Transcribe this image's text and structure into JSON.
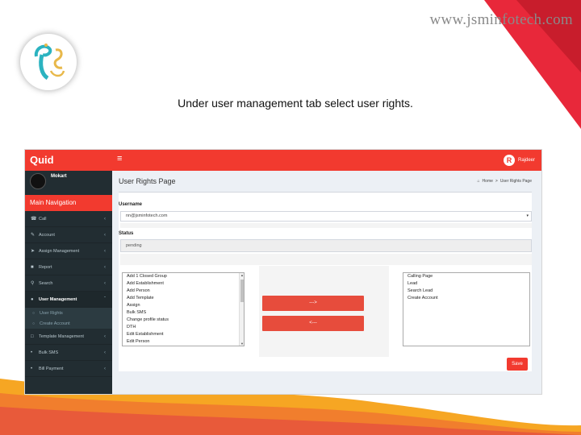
{
  "slide": {
    "watermark": "www.jsminfotech.com",
    "caption": "Under user management tab select user rights."
  },
  "app": {
    "brand": "Quid",
    "user_initial": "R",
    "user_name": "Rajdeer"
  },
  "sidebar": {
    "profile_name": "Mokart",
    "section_title": "Main Navigation",
    "items": [
      {
        "label": "Call"
      },
      {
        "label": "Account"
      },
      {
        "label": "Assign Management"
      },
      {
        "label": "Report"
      },
      {
        "label": "Search"
      },
      {
        "label": "User Management"
      },
      {
        "label": "Template Management"
      },
      {
        "label": "Bulk SMS"
      },
      {
        "label": "Bill Payment"
      }
    ],
    "sub_items": [
      {
        "label": "User Rights"
      },
      {
        "label": "Create Account"
      }
    ]
  },
  "page": {
    "title": "User Rights Page",
    "breadcrumb_home": "Home",
    "breadcrumb_current": "User Rights Page",
    "username_label": "Username",
    "username_value": "nn@jsminfotech.com",
    "status_label": "Status",
    "status_value": "pending",
    "move_right_label": "--->",
    "move_left_label": "<---",
    "save_label": "Save",
    "available_rights": [
      "Add 1 Closed Group",
      "Add Establishment",
      "Add Person",
      "Add Template",
      "Assign",
      "Bulk SMS",
      "Change profile status",
      "DTH",
      "Edit Establishment",
      "Edit Person"
    ],
    "assigned_rights": [
      "Calling Page",
      "Lead",
      "Search Lead",
      "Create Account"
    ]
  }
}
